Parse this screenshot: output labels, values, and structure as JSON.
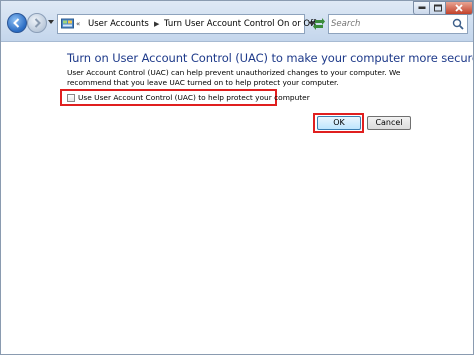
{
  "address_bar": {
    "recent_symbol": "«",
    "crumbs": [
      "User Accounts",
      "Turn User Account Control On or Off"
    ],
    "separator": "▶"
  },
  "search": {
    "placeholder": "Search"
  },
  "main": {
    "heading": "Turn on User Account Control (UAC) to make your computer more secure",
    "description": "User Account Control (UAC) can help prevent unauthorized changes to your computer.  We recommend that you leave UAC turned on to help protect your computer.",
    "checkbox_label": "Use User Account Control (UAC) to help protect your computer",
    "checkbox_checked": false
  },
  "buttons": {
    "ok": "OK",
    "cancel": "Cancel"
  },
  "colors": {
    "highlight": "#e01f1f",
    "heading": "#1e3a8a"
  }
}
